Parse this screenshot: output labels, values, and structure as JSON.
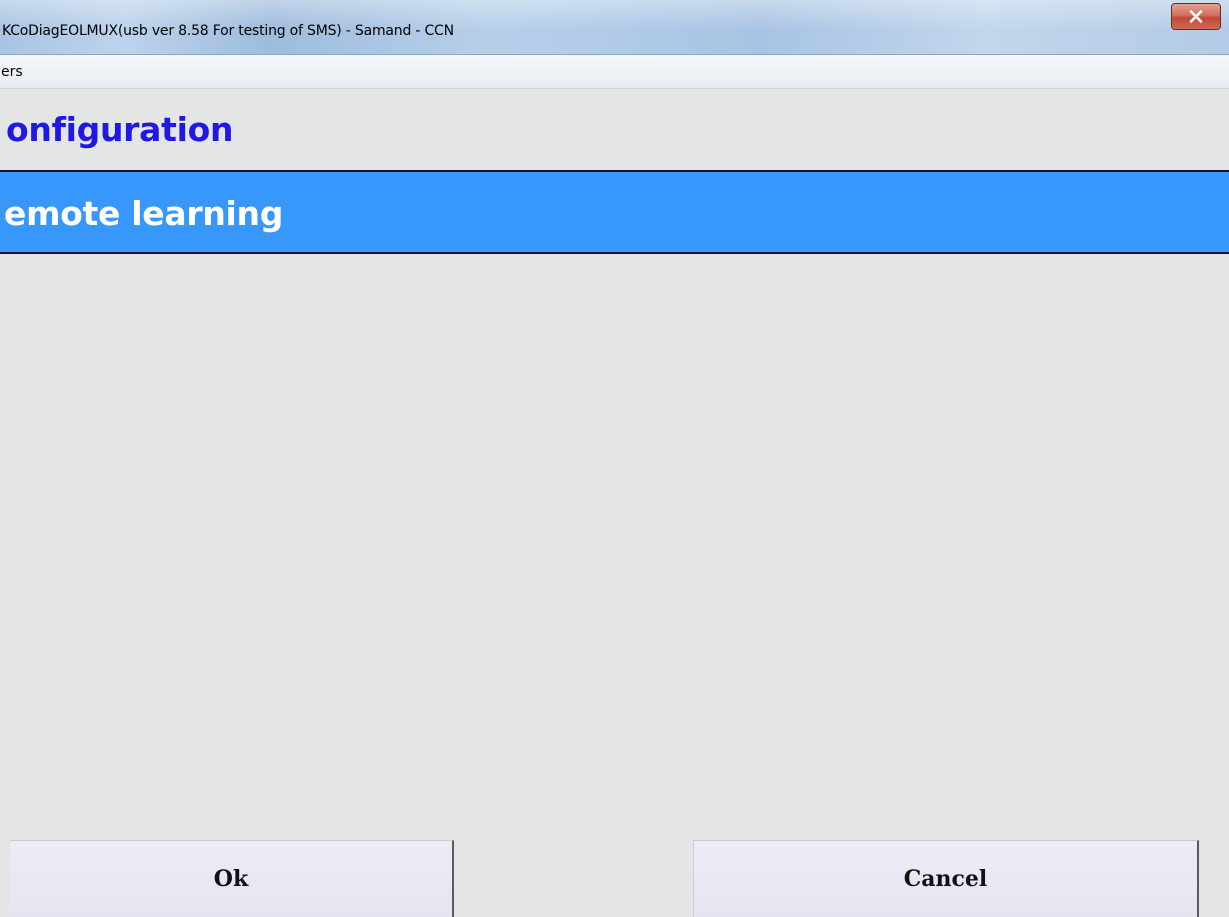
{
  "window": {
    "title": "KCoDiagEOLMUX(usb ver 8.58 For testing of SMS)  - Samand - CCN",
    "close_icon": "close-icon"
  },
  "menubar": {
    "items": [
      {
        "label": "ers"
      }
    ]
  },
  "content": {
    "section_title": "onfiguration",
    "selected_item": "emote learning"
  },
  "buttons": {
    "ok_label": "Ok",
    "cancel_label": "Cancel"
  },
  "colors": {
    "section_title": "#2018e4",
    "selection_background": "#3797fb",
    "selection_text": "#ffffff",
    "close_button": "#c9503c"
  }
}
